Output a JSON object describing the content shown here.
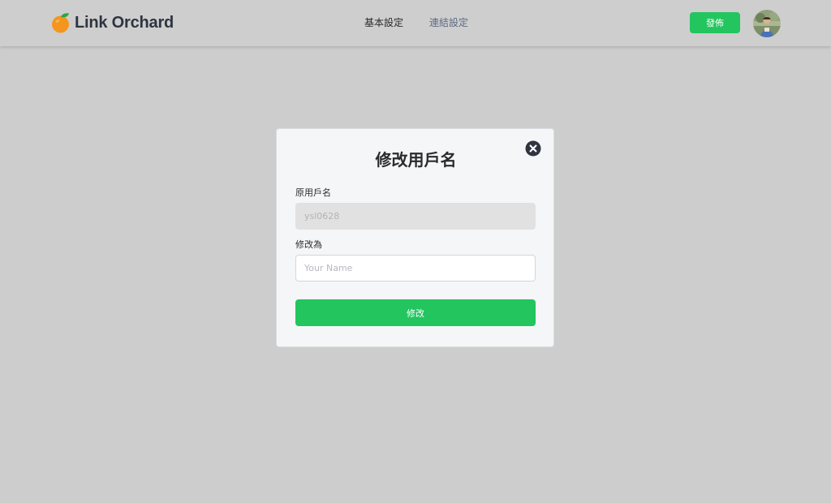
{
  "header": {
    "logo_text": "Link Orchard",
    "logo_icon": "orange-fruit-icon",
    "nav": [
      {
        "label": "基本設定"
      },
      {
        "label": "連結設定"
      }
    ],
    "publish_label": "發佈",
    "avatar_icon": "user-avatar"
  },
  "modal": {
    "title": "修改用戶名",
    "close_icon": "close-circle-icon",
    "original_label": "原用戶名",
    "original_value": "ysl0628",
    "new_label": "修改為",
    "new_placeholder": "Your Name",
    "new_value": "",
    "submit_label": "修改"
  },
  "colors": {
    "accent": "#22c55e",
    "overlay": "#cdcdcd",
    "text_dark": "#2b2b2b",
    "nav_inactive": "#5c6b84",
    "close_icon": "#2f3440"
  }
}
